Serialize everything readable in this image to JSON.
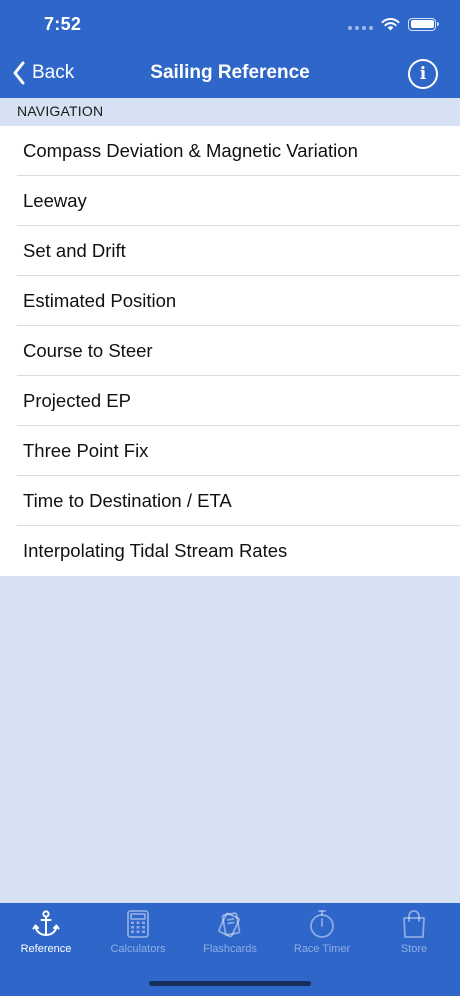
{
  "status_bar": {
    "time": "7:52"
  },
  "nav_bar": {
    "back_label": "Back",
    "title": "Sailing Reference",
    "info_icon": "info-icon"
  },
  "section": {
    "header": "NAVIGATION",
    "items": [
      "Compass Deviation & Magnetic Variation",
      "Leeway",
      "Set and Drift",
      "Estimated Position",
      "Course to Steer",
      "Projected EP",
      "Three Point Fix",
      "Time to Destination / ETA",
      "Interpolating Tidal Stream Rates"
    ]
  },
  "tab_bar": {
    "active": "Reference",
    "tabs": [
      {
        "label": "Reference",
        "icon": "anchor-icon"
      },
      {
        "label": "Calculators",
        "icon": "calculator-icon"
      },
      {
        "label": "Flashcards",
        "icon": "flashcards-icon"
      },
      {
        "label": "Race Timer",
        "icon": "stopwatch-icon"
      },
      {
        "label": "Store",
        "icon": "shopping-bag-icon"
      }
    ]
  },
  "colors": {
    "brand": "#2f66c9",
    "background": "#d6e2f3"
  }
}
